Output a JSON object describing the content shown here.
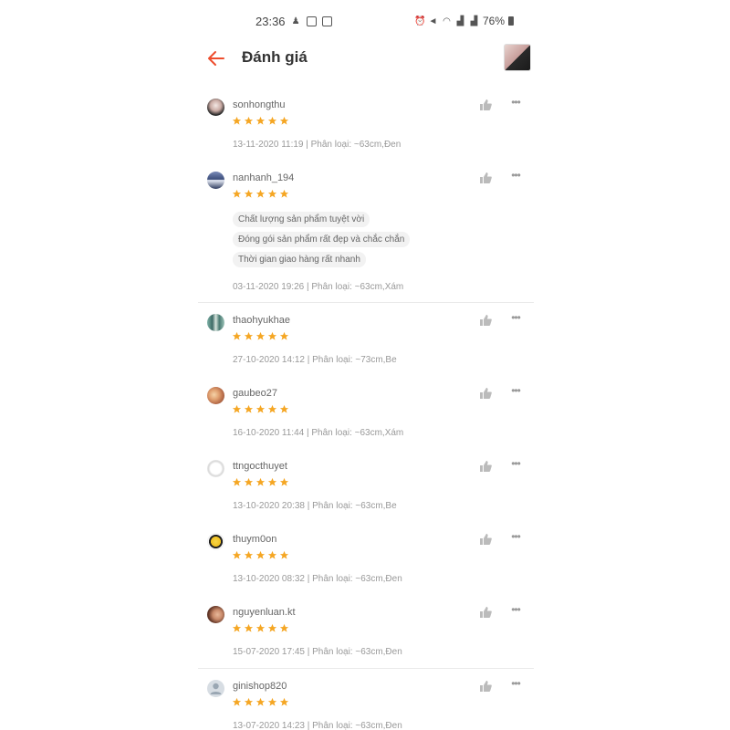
{
  "status_bar": {
    "time": "23:36",
    "battery": "76%"
  },
  "header": {
    "title": "Đánh giá"
  },
  "colors": {
    "accent": "#ee4d2d",
    "star": "#f5a623"
  },
  "reviews": [
    {
      "username": "sonhongthu",
      "rating": 5,
      "meta": "13-11-2020 11:19 | Phân loại: ~63cm,Đen",
      "tags": []
    },
    {
      "username": "nanhanh_194",
      "rating": 5,
      "meta": "03-11-2020 19:26 | Phân loại: ~63cm,Xám",
      "tags": [
        "Chất lượng sản phẩm tuyệt vời",
        "Đóng gói sản phẩm rất đẹp và chắc chắn",
        "Thời gian giao hàng rất nhanh"
      ]
    },
    {
      "username": "thaohyukhae",
      "rating": 5,
      "meta": "27-10-2020 14:12 | Phân loại: ~73cm,Be",
      "tags": []
    },
    {
      "username": "gaubeo27",
      "rating": 5,
      "meta": "16-10-2020 11:44 | Phân loại: ~63cm,Xám",
      "tags": []
    },
    {
      "username": "ttngocthuyet",
      "rating": 5,
      "meta": "13-10-2020 20:38 | Phân loại: ~63cm,Be",
      "tags": []
    },
    {
      "username": "thuym0on",
      "rating": 5,
      "meta": "13-10-2020 08:32 | Phân loại: ~63cm,Đen",
      "tags": []
    },
    {
      "username": "nguyenluan.kt",
      "rating": 5,
      "meta": "15-07-2020 17:45 | Phân loại: ~63cm,Đen",
      "tags": []
    },
    {
      "username": "ginishop820",
      "rating": 5,
      "meta": "13-07-2020 14:23 | Phân loại: ~63cm,Đen",
      "tags": []
    }
  ]
}
